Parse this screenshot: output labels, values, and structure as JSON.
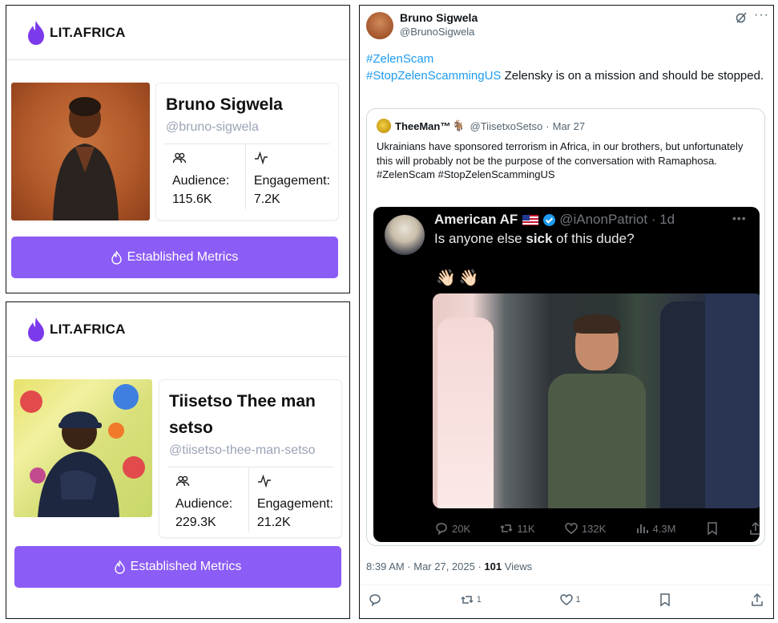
{
  "cards": [
    {
      "brand": "LIT.AFRICA",
      "name": "Bruno Sigwela",
      "handle": "@bruno-sigwela",
      "audience_label": "Audience:",
      "audience_value": "115.6K",
      "engagement_label": "Engagement:",
      "engagement_value": "7.2K",
      "button_label": "Established Metrics"
    },
    {
      "brand": "LIT.AFRICA",
      "name": "Tiisetso Thee man setso",
      "handle": "@tiisetso-thee-man-setso",
      "audience_label": "Audience:",
      "audience_value": "229.3K",
      "engagement_label": "Engagement:",
      "engagement_value": "21.2K",
      "button_label": "Established Metrics"
    }
  ],
  "colors": {
    "brand_purple": "#8b5cf6",
    "link_blue": "#1d9bf0"
  },
  "tweet": {
    "author_name": "Bruno Sigwela",
    "author_handle": "@BrunoSigwela",
    "hashtag1": "#ZelenScam",
    "hashtag2": "#StopZelenScammingUS",
    "text_rest": " Zelensky is on a mission and should be stopped.",
    "quote": {
      "name": "TheeMan™",
      "handle": "@TiisetxoSetso",
      "dot": "·",
      "date": "Mar 27",
      "text": "Ukrainians have sponsored terrorism in Africa, in our brothers, but unfortunately this will probably not be the purpose of the conversation with Ramaphosa. #ZelenScam #StopZelenScammingUS",
      "media": {
        "name": "American AF",
        "handle": "@iAnonPatriot · 1d",
        "text_before": "Is anyone else ",
        "text_bold": "sick",
        "text_after": " of this dude?",
        "emoji": "👋🏻👋🏻",
        "replies": "20K",
        "reposts": "11K",
        "likes": "132K",
        "views": "4.3M"
      }
    },
    "timestamp": "8:39 AM · Mar 27, 2025 · ",
    "views_count": "101",
    "views_label": " Views",
    "reposts": "1",
    "likes": "1"
  }
}
